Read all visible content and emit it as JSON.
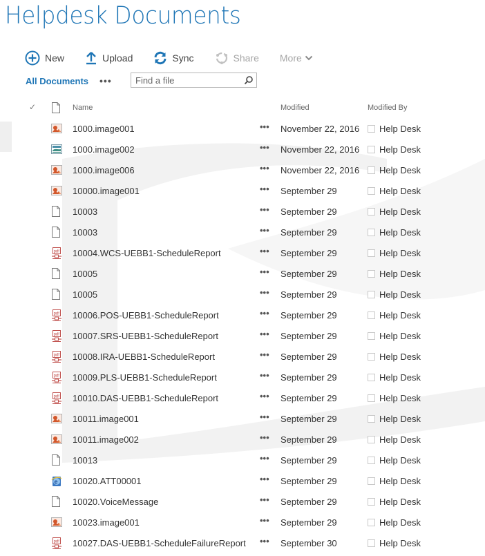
{
  "page": {
    "title": "Helpdesk Documents"
  },
  "toolbar": {
    "new_label": "New",
    "upload_label": "Upload",
    "sync_label": "Sync",
    "share_label": "Share",
    "more_label": "More",
    "accent_color": "#1f76b6"
  },
  "view": {
    "name": "All Documents",
    "more_label": "•••",
    "search_placeholder": "Find a file"
  },
  "columns": {
    "check": "✓",
    "name": "Name",
    "modified": "Modified",
    "modified_by": "Modified By"
  },
  "rows": [
    {
      "icon": "image-file-icon",
      "name": "1000.image001",
      "modified": "November 22, 2016",
      "modified_by": "Help Desk"
    },
    {
      "icon": "picture-file-icon",
      "name": "1000.image002",
      "modified": "November 22, 2016",
      "modified_by": "Help Desk"
    },
    {
      "icon": "image-file-icon",
      "name": "1000.image006",
      "modified": "November 22, 2016",
      "modified_by": "Help Desk"
    },
    {
      "icon": "image-file-icon",
      "name": "10000.image001",
      "modified": "September 29",
      "modified_by": "Help Desk"
    },
    {
      "icon": "generic-file-icon",
      "name": "10003",
      "modified": "September 29",
      "modified_by": "Help Desk"
    },
    {
      "icon": "generic-file-icon",
      "name": "10003",
      "modified": "September 29",
      "modified_by": "Help Desk"
    },
    {
      "icon": "pdf-file-icon",
      "name": "10004.WCS-UEBB1-ScheduleReport",
      "modified": "September 29",
      "modified_by": "Help Desk"
    },
    {
      "icon": "generic-file-icon",
      "name": "10005",
      "modified": "September 29",
      "modified_by": "Help Desk"
    },
    {
      "icon": "generic-file-icon",
      "name": "10005",
      "modified": "September 29",
      "modified_by": "Help Desk"
    },
    {
      "icon": "pdf-file-icon",
      "name": "10006.POS-UEBB1-ScheduleReport",
      "modified": "September 29",
      "modified_by": "Help Desk"
    },
    {
      "icon": "pdf-file-icon",
      "name": "10007.SRS-UEBB1-ScheduleReport",
      "modified": "September 29",
      "modified_by": "Help Desk"
    },
    {
      "icon": "pdf-file-icon",
      "name": "10008.IRA-UEBB1-ScheduleReport",
      "modified": "September 29",
      "modified_by": "Help Desk"
    },
    {
      "icon": "pdf-file-icon",
      "name": "10009.PLS-UEBB1-ScheduleReport",
      "modified": "September 29",
      "modified_by": "Help Desk"
    },
    {
      "icon": "pdf-file-icon",
      "name": "10010.DAS-UEBB1-ScheduleReport",
      "modified": "September 29",
      "modified_by": "Help Desk"
    },
    {
      "icon": "image-file-icon",
      "name": "10011.image001",
      "modified": "September 29",
      "modified_by": "Help Desk"
    },
    {
      "icon": "image-file-icon",
      "name": "10011.image002",
      "modified": "September 29",
      "modified_by": "Help Desk"
    },
    {
      "icon": "generic-file-icon",
      "name": "10013",
      "modified": "September 29",
      "modified_by": "Help Desk"
    },
    {
      "icon": "html-file-icon",
      "name": "10020.ATT00001",
      "modified": "September 29",
      "modified_by": "Help Desk"
    },
    {
      "icon": "generic-file-icon",
      "name": "10020.VoiceMessage",
      "modified": "September 29",
      "modified_by": "Help Desk"
    },
    {
      "icon": "image-file-icon",
      "name": "10023.image001",
      "modified": "September 29",
      "modified_by": "Help Desk"
    },
    {
      "icon": "pdf-file-icon",
      "name": "10027.DAS-UEBB1-ScheduleFailureReport",
      "modified": "September 30",
      "modified_by": "Help Desk"
    }
  ],
  "row_menu_label": "•••"
}
